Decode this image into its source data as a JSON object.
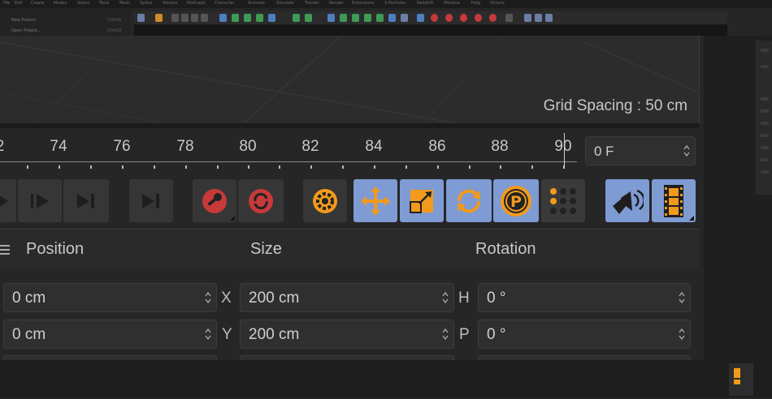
{
  "menu": {
    "items": [
      "File",
      "Edit",
      "Create",
      "Modes",
      "Select",
      "Tools",
      "Mesh",
      "Spline",
      "Volume",
      "MoGraph",
      "Character",
      "Animate",
      "Simulate",
      "Tracker",
      "Render",
      "Extensions",
      "X-Particles",
      "Redshift",
      "Window",
      "Help",
      "Octane"
    ]
  },
  "recent_files": [
    {
      "label": "New Project",
      "shortcut": "Ctrl+N"
    },
    {
      "label": "Open Project...",
      "shortcut": "Ctrl+O"
    }
  ],
  "viewport": {
    "grid_spacing_label": "Grid Spacing : 50 cm"
  },
  "timeline": {
    "first_partial_label": "2",
    "ticks": [
      "74",
      "76",
      "78",
      "80",
      "82",
      "84",
      "86",
      "88",
      "90"
    ],
    "current_frame": "0 F"
  },
  "playback": {
    "buttons": [
      {
        "name": "play-reverse-button",
        "icon": "play-icon"
      },
      {
        "name": "play-forward-button",
        "icon": "play-forward-icon"
      },
      {
        "name": "go-to-next-key-button",
        "icon": "step-next-icon"
      },
      {
        "name": "go-to-end-button",
        "icon": "go-to-end-icon"
      },
      {
        "name": "record-keys-button",
        "icon": "record-key-icon"
      },
      {
        "name": "autokeying-button",
        "icon": "autokey-icon"
      },
      {
        "name": "keyframe-selection-button",
        "icon": "gear-icon"
      },
      {
        "name": "record-position-button",
        "icon": "move-arrows-icon"
      },
      {
        "name": "record-scale-button",
        "icon": "scale-icon"
      },
      {
        "name": "record-rotation-button",
        "icon": "rotation-icon"
      },
      {
        "name": "record-parameter-button",
        "icon": "parameter-p-icon"
      },
      {
        "name": "record-point-level-button",
        "icon": "point-grid-icon"
      },
      {
        "name": "sound-button",
        "icon": "speaker-icon"
      },
      {
        "name": "film-button",
        "icon": "film-strip-icon"
      }
    ]
  },
  "attributes": {
    "headers": {
      "position": "Position",
      "size": "Size",
      "rotation": "Rotation"
    },
    "rows": [
      {
        "position": "0 cm",
        "size_axis": "X",
        "size": "200 cm",
        "rot_axis": "H",
        "rotation": "0 °"
      },
      {
        "position": "0 cm",
        "size_axis": "Y",
        "size": "200 cm",
        "rot_axis": "P",
        "rotation": "0 °"
      }
    ]
  },
  "colors": {
    "accent_blue": "#7f9bd3",
    "orange": "#f29a1c",
    "red": "#c73a3a"
  }
}
